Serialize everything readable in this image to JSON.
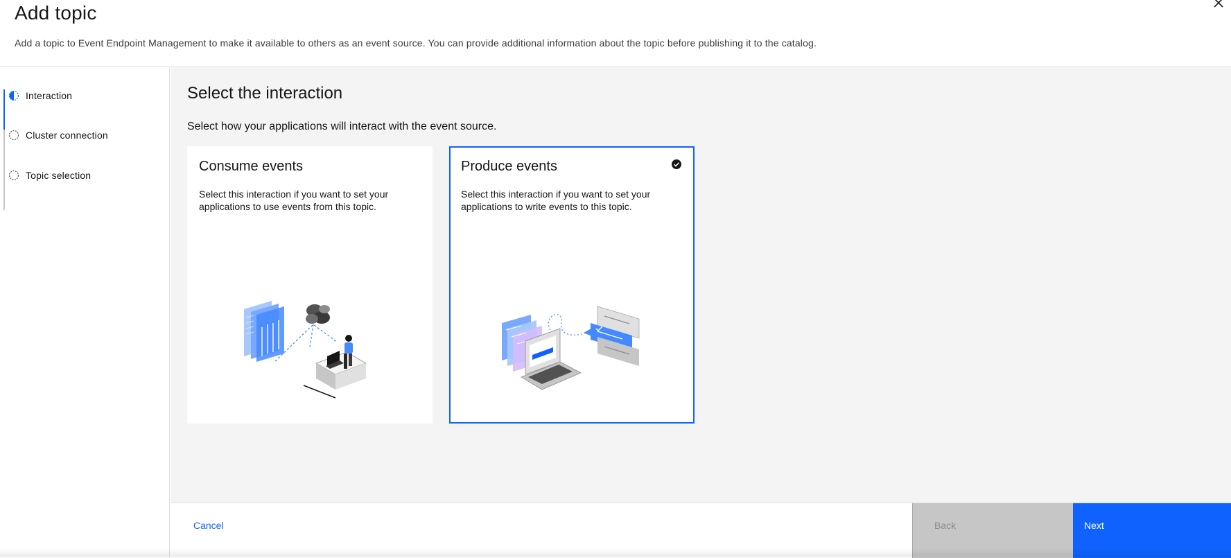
{
  "header": {
    "title": "Add topic",
    "description": "Add a topic to Event Endpoint Management to make it available to others as an event source. You can provide additional information about the topic before publishing it to the catalog."
  },
  "steps": [
    {
      "label": "Interaction",
      "state": "current"
    },
    {
      "label": "Cluster connection",
      "state": "incomplete"
    },
    {
      "label": "Topic selection",
      "state": "incomplete"
    }
  ],
  "main": {
    "heading": "Select the interaction",
    "description": "Select how your applications will interact with the event source."
  },
  "tiles": [
    {
      "title": "Consume events",
      "description": "Select this interaction if you want to set your applications to use events from this topic.",
      "selected": false
    },
    {
      "title": "Produce events",
      "description": "Select this interaction if you want to set your applications to write events to this topic.",
      "selected": true
    }
  ],
  "footer": {
    "cancel_label": "Cancel",
    "back_label": "Back",
    "next_label": "Next"
  },
  "colors": {
    "accent": "#0f62fe",
    "background": "#f4f4f4",
    "disabled": "#c6c6c6"
  }
}
